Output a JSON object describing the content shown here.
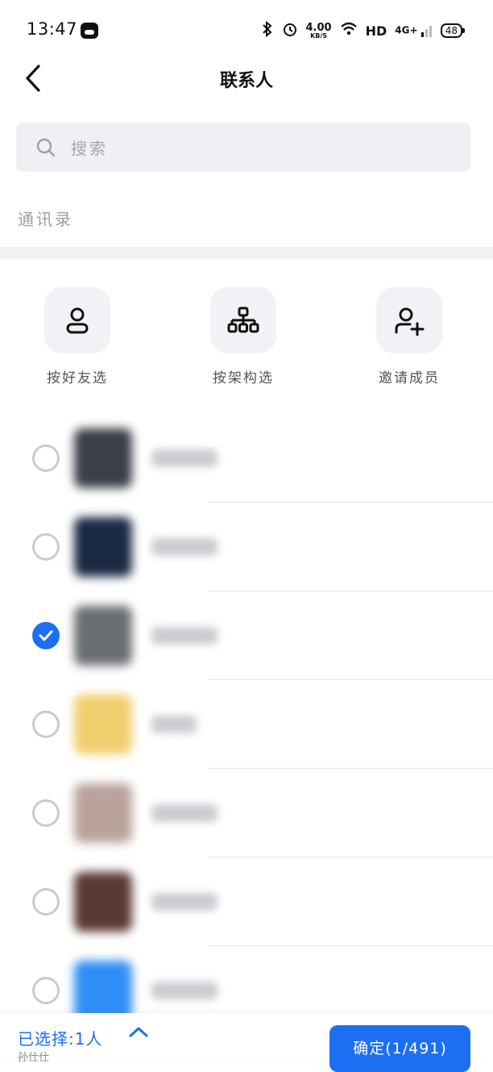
{
  "status_bar": {
    "time": "13:47",
    "speed_value": "4.00",
    "speed_unit": "KB/S",
    "network": "HD",
    "signal": "4G+",
    "battery": "48"
  },
  "header": {
    "title": "联系人"
  },
  "search": {
    "placeholder": "搜索"
  },
  "section": {
    "label": "通讯录"
  },
  "quick_actions": [
    {
      "label": "按好友选",
      "icon": "person-icon"
    },
    {
      "label": "按架构选",
      "icon": "org-chart-icon"
    },
    {
      "label": "邀请成员",
      "icon": "add-person-icon"
    }
  ],
  "contacts": [
    {
      "checked": false,
      "avatar_color": "#3a3f4a"
    },
    {
      "checked": false,
      "avatar_color": "#1b2a44"
    },
    {
      "checked": true,
      "avatar_color": "#6b6e73"
    },
    {
      "checked": false,
      "avatar_color": "#f0cf6e"
    },
    {
      "checked": false,
      "avatar_color": "#b9a39c"
    },
    {
      "checked": false,
      "avatar_color": "#5a3a34"
    },
    {
      "checked": false,
      "avatar_color": "#2f8ef5"
    }
  ],
  "bottom_bar": {
    "selected_label": "已选择:1人",
    "sub_label": "孙仕仕",
    "confirm_label": "确定(1/491)"
  },
  "colors": {
    "accent": "#1d6ff2",
    "tile_bg": "#f0f2f5",
    "search_bg": "#eef0f3"
  }
}
